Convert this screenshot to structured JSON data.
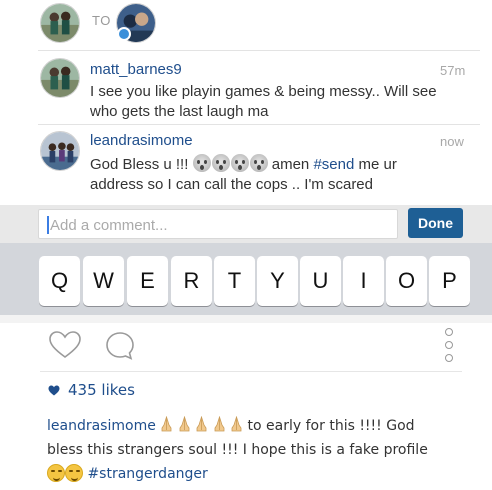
{
  "header": {
    "to_label": "TO"
  },
  "comments": [
    {
      "username": "matt_barnes9",
      "time": "57m",
      "line1": "I see you like playin games & being messy.. Will see",
      "line2": "who gets the last laugh ma"
    },
    {
      "username": "leandrasimome",
      "time": "now",
      "line1_a": "God Bless u !!!",
      "line1_b": "amen",
      "hashtag": "#send",
      "line1_c": "me ur",
      "line2": "address so I can call the cops .. I'm scared"
    }
  ],
  "input": {
    "placeholder": "Add a comment...",
    "done_label": "Done"
  },
  "keyboard": {
    "keys": [
      "Q",
      "W",
      "E",
      "R",
      "T",
      "Y",
      "U",
      "I",
      "O",
      "P"
    ]
  },
  "post": {
    "likes": "435 likes",
    "caption_user": "leandrasimome",
    "caption_line1": "to early for this !!!! God",
    "caption_line2": "bless this strangers soul !!! I hope this is a fake profile",
    "caption_hashtag": "#strangerdanger"
  },
  "colors": {
    "link_blue": "#1f4e8c",
    "done_blue": "#1e5f95"
  },
  "icons": [
    "heart-icon",
    "comment-icon",
    "more-options-icon",
    "small-heart-icon",
    "praying-hands-emoji",
    "scream-emoji",
    "smile-emoji"
  ]
}
